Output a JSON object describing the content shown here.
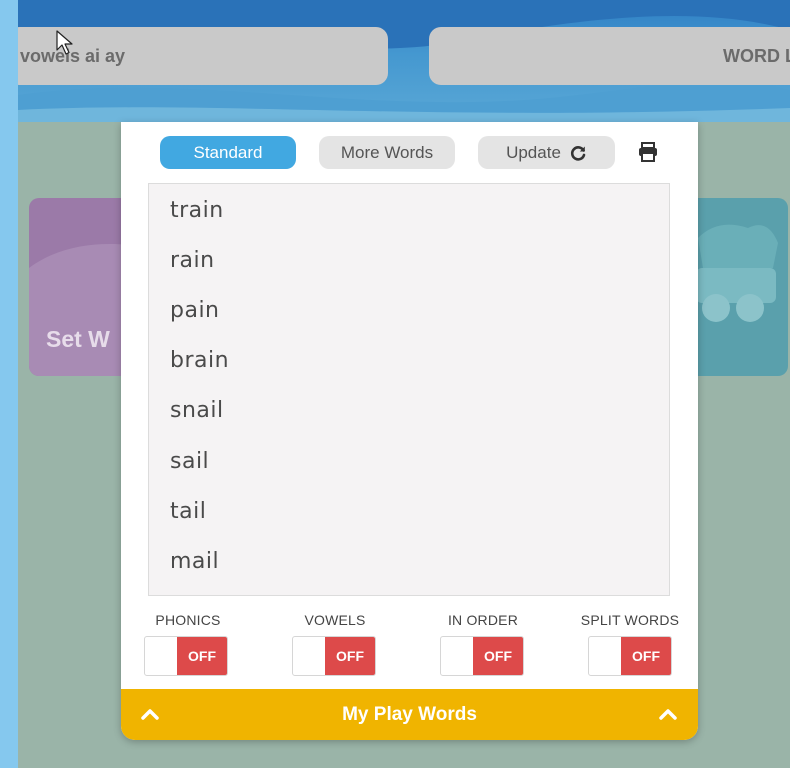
{
  "header": {
    "left_pill_label": "vowels ai ay",
    "right_pill_label": "WORD LI"
  },
  "background_cards": {
    "left_label": "Set W"
  },
  "panel": {
    "tabs": [
      {
        "label": "Standard",
        "active": true
      },
      {
        "label": "More Words",
        "active": false
      },
      {
        "label": "Update",
        "icon": "refresh-icon",
        "active": false
      }
    ],
    "print_icon": "printer-icon",
    "words": [
      "train",
      "rain",
      "pain",
      "brain",
      "snail",
      "sail",
      "tail",
      "mail"
    ],
    "toggles": [
      {
        "label": "PHONICS",
        "state": "OFF"
      },
      {
        "label": "VOWELS",
        "state": "OFF"
      },
      {
        "label": "IN ORDER",
        "state": "OFF"
      },
      {
        "label": "SPLIT WORDS",
        "state": "OFF"
      }
    ],
    "footer": {
      "label": "My Play Words",
      "icon": "chevron-up-icon"
    }
  },
  "colors": {
    "accent_blue": "#41a8e1",
    "toggle_off": "#dd4a4a",
    "footer_yellow": "#f0b400",
    "page_bg": "#9ab4a8"
  }
}
